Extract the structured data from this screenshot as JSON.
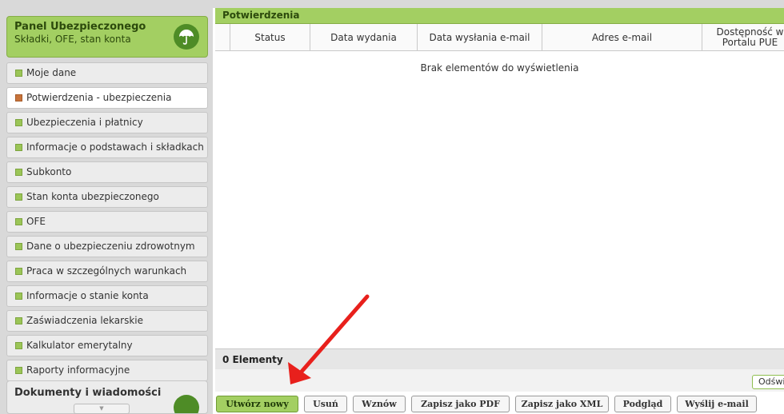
{
  "sidebar": {
    "panel_title": "Panel Ubezpieczonego",
    "panel_subtitle": "Składki, OFE, stan konta",
    "panel_icon": "umbrella-icon",
    "items": [
      {
        "label": "Moje dane",
        "active": false
      },
      {
        "label": "Potwierdzenia - ubezpieczenia",
        "active": true
      },
      {
        "label": "Ubezpieczenia i płatnicy",
        "active": false
      },
      {
        "label": "Informacje o podstawach i składkach",
        "active": false
      },
      {
        "label": "Subkonto",
        "active": false
      },
      {
        "label": "Stan konta ubezpieczonego",
        "active": false
      },
      {
        "label": "OFE",
        "active": false
      },
      {
        "label": "Dane o ubezpieczeniu zdrowotnym",
        "active": false
      },
      {
        "label": "Praca w szczególnych warunkach",
        "active": false
      },
      {
        "label": "Informacje o stanie konta",
        "active": false
      },
      {
        "label": "Zaświadczenia lekarskie",
        "active": false
      },
      {
        "label": "Kalkulator emerytalny",
        "active": false
      },
      {
        "label": "Raporty informacyjne",
        "active": false
      }
    ],
    "panel2_title": "Dokumenty i wiadomości",
    "scroll_down_glyph": "▼"
  },
  "main": {
    "title": "Potwierdzenia",
    "columns": [
      "Status",
      "Data wydania",
      "Data wysłania e-mail",
      "Adres e-mail",
      "Dostępność w Portalu PUE"
    ],
    "empty_message": "Brak elementów do wyświetlenia",
    "count_label": "0 Elementy",
    "refresh_label": "Odśwież"
  },
  "buttons": [
    "Utwórz nowy",
    "Usuń",
    "Wznów",
    "Zapisz jako PDF",
    "Zapisz jako XML",
    "Podgląd",
    "Wyślij e-mail"
  ],
  "colors": {
    "accent_green": "#a3cf62",
    "dark_green": "#4e8c26",
    "arrow_red": "#e8201c"
  }
}
